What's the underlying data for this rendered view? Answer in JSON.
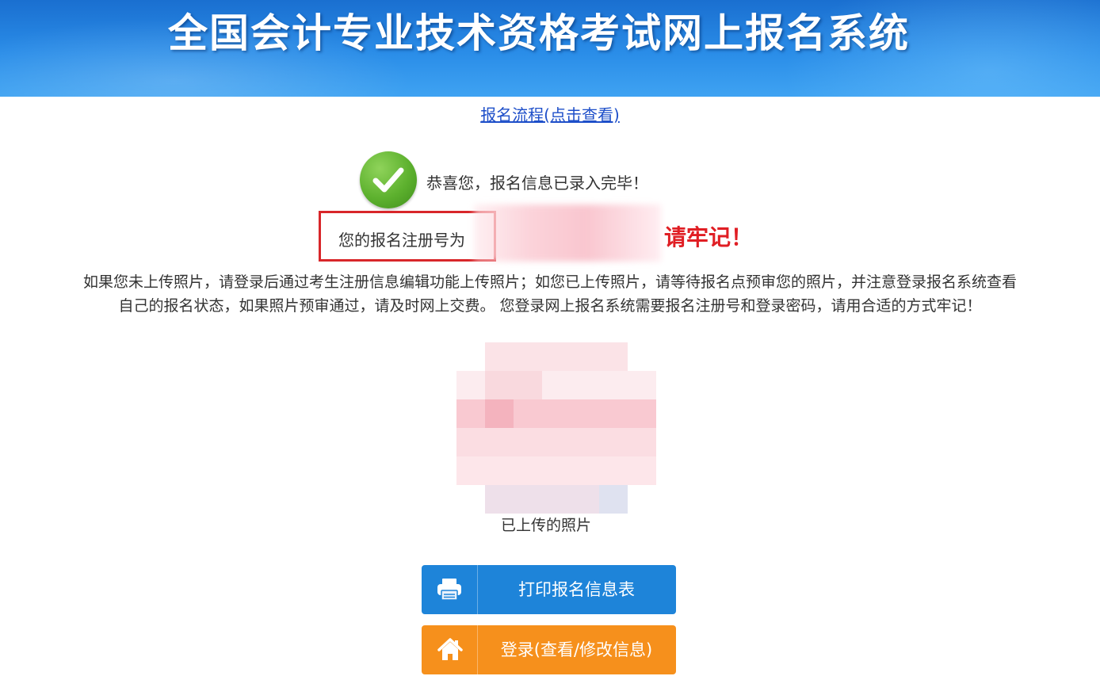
{
  "header": {
    "title": "全国会计专业技术资格考试网上报名系统"
  },
  "process_link": "报名流程(点击查看)",
  "success": {
    "icon": "check-circle-icon",
    "message": "恭喜您，报名信息已录入完毕！"
  },
  "registration": {
    "label": "您的报名注册号为",
    "reminder": "请牢记！"
  },
  "notice": {
    "line1": "如果您未上传照片，请登录后通过考生注册信息编辑功能上传照片；如您已上传照片，请等待报名点预审您的照片，并注意登录报名系统查看",
    "line2": "自己的报名状态，如果照片预审通过，请及时网上交费。 您登录网上报名系统需要报名注册号和登录密码，请用合适的方式牢记！"
  },
  "photo": {
    "caption": "已上传的照片"
  },
  "buttons": {
    "print_label": "打印报名信息表",
    "print_icon": "printer-icon",
    "login_label": "登录(查看/修改信息)",
    "login_icon": "home-icon"
  },
  "colors": {
    "header_blue": "#2a8de8",
    "link_blue": "#1e4fc9",
    "success_green": "#5db12e",
    "alert_red": "#e01e24",
    "print_button_blue": "#1e84d9",
    "login_button_orange": "#f6901c"
  }
}
